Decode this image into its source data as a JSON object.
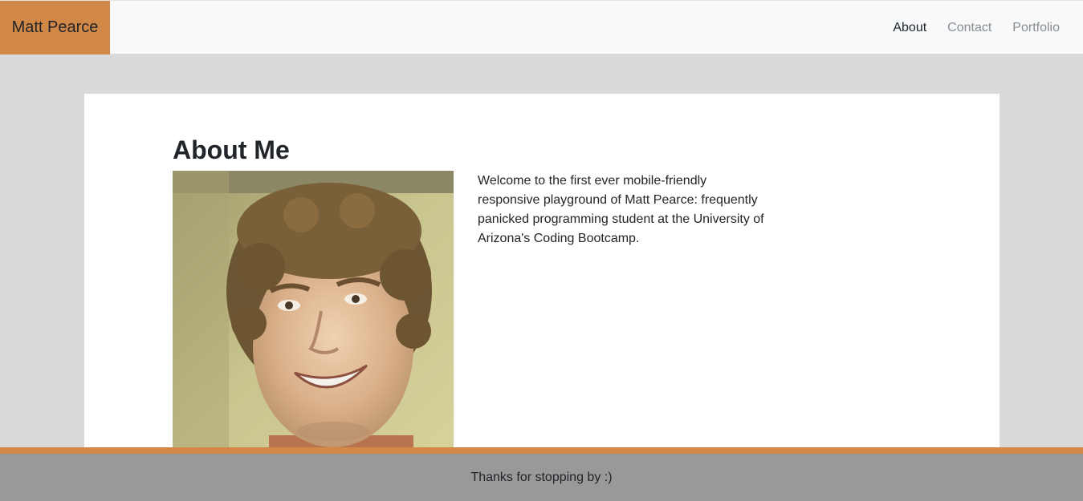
{
  "navbar": {
    "brand": "Matt Pearce",
    "links": [
      {
        "label": "About",
        "active": true
      },
      {
        "label": "Contact",
        "active": false
      },
      {
        "label": "Portfolio",
        "active": false
      }
    ]
  },
  "about": {
    "heading": "About Me",
    "bio": "Welcome to the first ever mobile-friendly responsive playground of Matt Pearce: frequently panicked programming student at the University of Arizona's Coding Bootcamp."
  },
  "footer": {
    "text": "Thanks for stopping by :)"
  },
  "colors": {
    "accent": "#d28847",
    "nav_bg": "#f8f9fa",
    "page_bg": "#dadada",
    "footer_bg": "#999999"
  }
}
